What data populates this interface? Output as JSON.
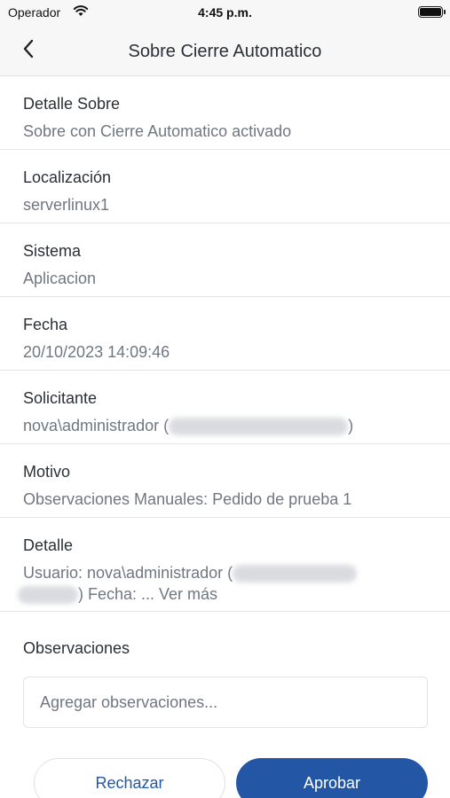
{
  "status_bar": {
    "carrier": "Operador",
    "time": "4:45 p.m."
  },
  "nav": {
    "title": "Sobre Cierre Automatico"
  },
  "fields": [
    {
      "label": "Detalle Sobre",
      "value": "Sobre con Cierre Automatico activado"
    },
    {
      "label": "Localización",
      "value": "serverlinux1"
    },
    {
      "label": "Sistema",
      "value": "Aplicacion"
    },
    {
      "label": "Fecha",
      "value": "20/10/2023 14:09:46"
    },
    {
      "label": "Solicitante",
      "value_prefix": "nova\\administrador (",
      "value_suffix": ")"
    },
    {
      "label": "Motivo",
      "value": "Observaciones Manuales: Pedido de prueba 1"
    },
    {
      "label": "Detalle",
      "value_line1": "Usuario: nova\\administrador (",
      "value_line2": ")  Fecha: ... Ver más"
    }
  ],
  "observations": {
    "label": "Observaciones",
    "placeholder": "Agregar observaciones..."
  },
  "actions": {
    "reject_label": "Rechazar",
    "approve_label": "Aprobar"
  },
  "colors": {
    "primary": "#2357a6",
    "label": "#2b2f36",
    "value": "#707780"
  }
}
